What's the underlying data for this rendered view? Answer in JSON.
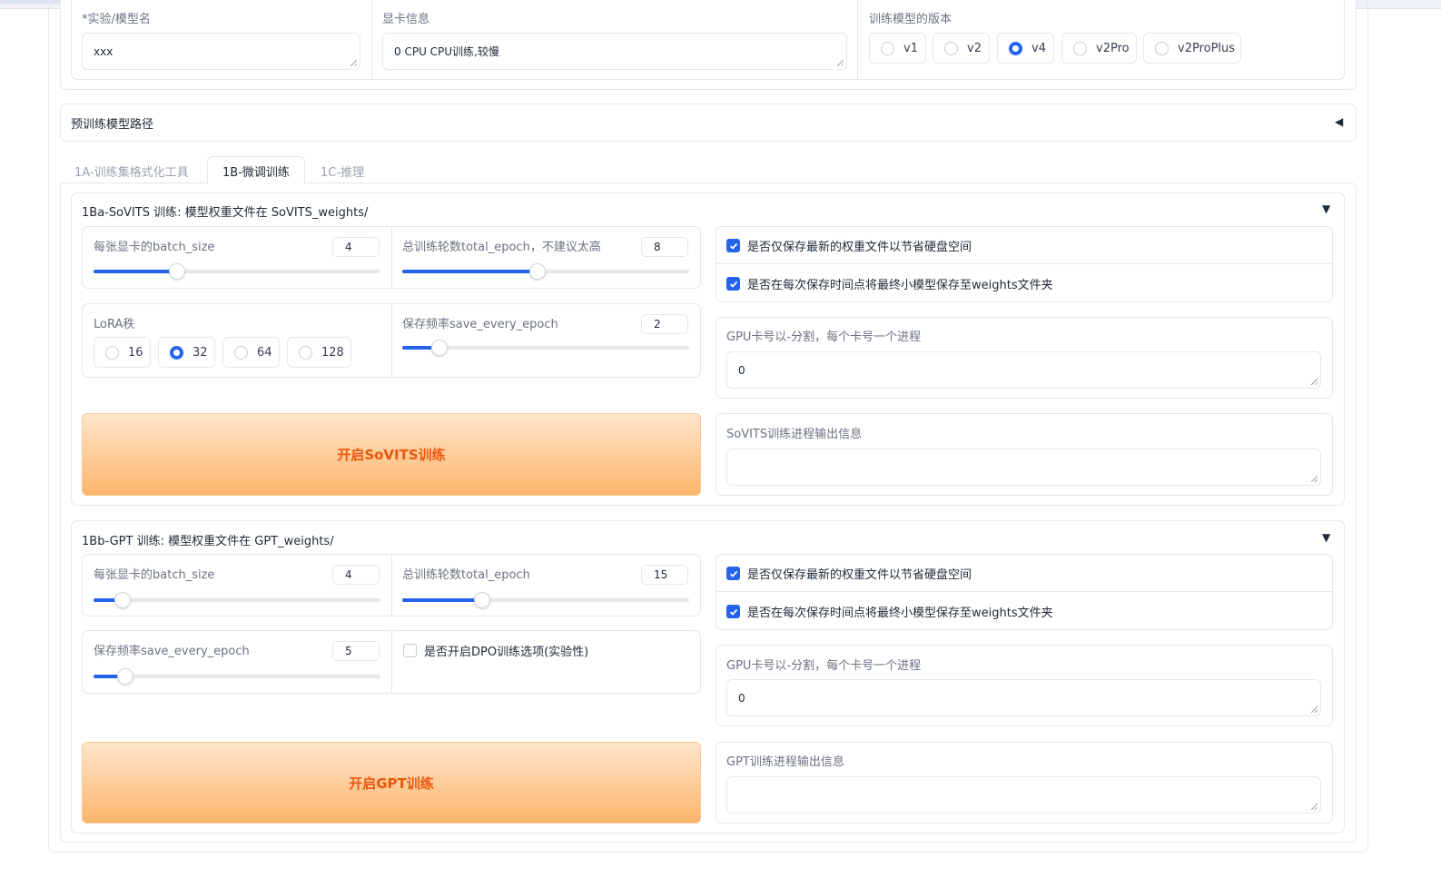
{
  "top": {
    "model_name_label": "*实验/模型名",
    "model_name_value": "xxx",
    "gpu_info_label": "显卡信息",
    "gpu_info_value": "0 CPU CPU训练,较慢",
    "version_label": "训练模型的版本",
    "versions": [
      "v1",
      "v2",
      "v4",
      "v2Pro",
      "v2ProPlus"
    ],
    "version_selected": "v4"
  },
  "pretrained": {
    "label": "预训练模型路径"
  },
  "tabs": [
    "1A-训练集格式化工具",
    "1B-微调训练",
    "1C-推理"
  ],
  "active_tab": "1B-微调训练",
  "sovits": {
    "title": "1Ba-SoVITS 训练: 模型权重文件在 SoVITS_weights/",
    "batch_size": {
      "label": "每张显卡的batch_size",
      "value": "4",
      "fraction": 0.29
    },
    "total_epoch": {
      "label": "总训练轮数total_epoch，不建议太高",
      "value": "8",
      "fraction": 0.47
    },
    "lora": {
      "label": "LoRA秩",
      "options": [
        "16",
        "32",
        "64",
        "128"
      ],
      "selected": "32"
    },
    "save_every": {
      "label": "保存频率save_every_epoch",
      "value": "2",
      "fraction": 0.13
    },
    "save_latest": {
      "label": "是否仅保存最新的权重文件以节省硬盘空间",
      "checked": true
    },
    "save_small": {
      "label": "是否在每次保存时间点将最终小模型保存至weights文件夹",
      "checked": true
    },
    "gpu_label": "GPU卡号以-分割，每个卡号一个进程",
    "gpu_value": "0",
    "start_button": "开启SoVITS训练",
    "output_label": "SoVITS训练进程输出信息",
    "output_value": ""
  },
  "gpt": {
    "title": "1Bb-GPT 训练: 模型权重文件在 GPT_weights/",
    "batch_size": {
      "label": "每张显卡的batch_size",
      "value": "4",
      "fraction": 0.1
    },
    "total_epoch": {
      "label": "总训练轮数total_epoch",
      "value": "15",
      "fraction": 0.28
    },
    "save_every": {
      "label": "保存频率save_every_epoch",
      "value": "5",
      "fraction": 0.11
    },
    "dpo": {
      "label": "是否开启DPO训练选项(实验性)",
      "checked": false
    },
    "save_latest": {
      "label": "是否仅保存最新的权重文件以节省硬盘空间",
      "checked": true
    },
    "save_small": {
      "label": "是否在每次保存时间点将最终小模型保存至weights文件夹",
      "checked": true
    },
    "gpu_label": "GPU卡号以-分割，每个卡号一个进程",
    "gpu_value": "0",
    "start_button": "开启GPT训练",
    "output_label": "GPT训练进程输出信息",
    "output_value": ""
  },
  "colors": {
    "accent": "#2563eb",
    "button_text": "#ea580c",
    "button_bg_top": "#ffe6cc",
    "button_bg_bottom": "#fbb56c"
  }
}
